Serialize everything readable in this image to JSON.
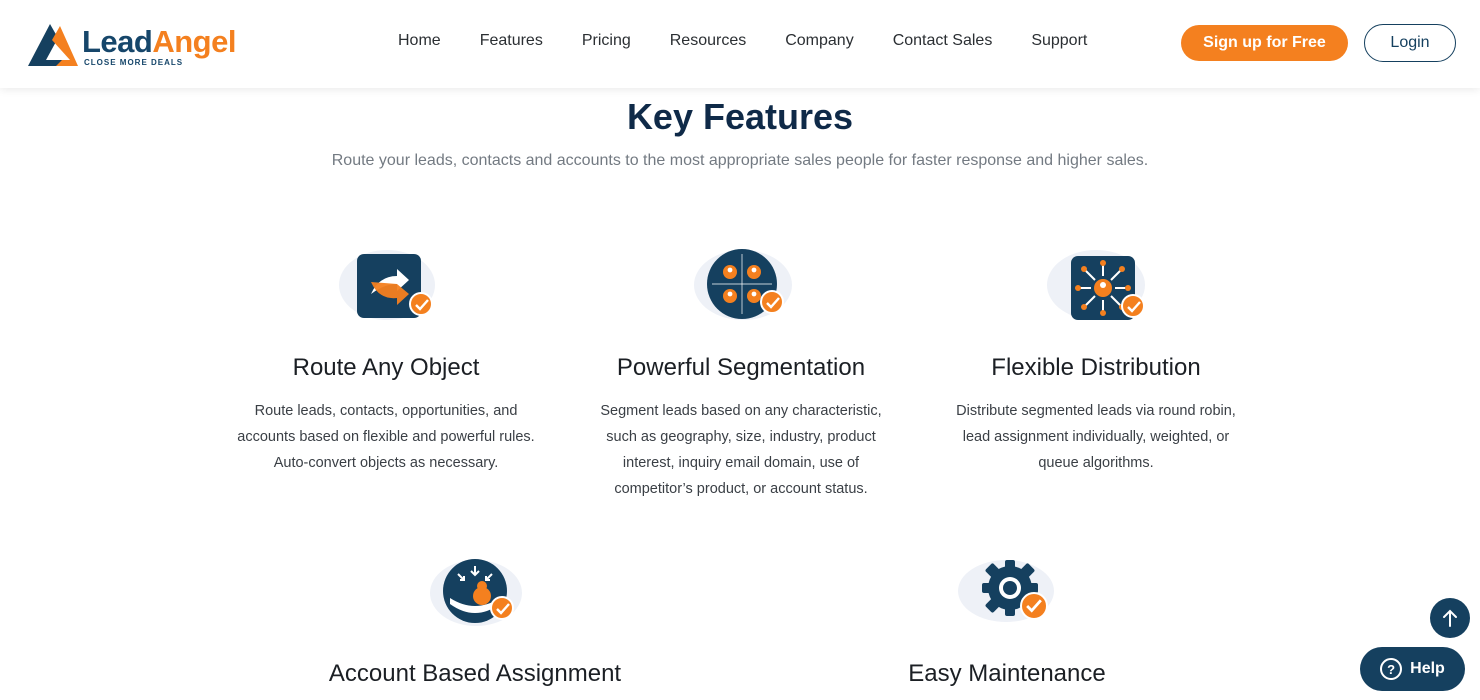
{
  "brand": {
    "name_part1": "Lead",
    "name_part2": "Angel",
    "tagline": "CLOSE MORE DEALS",
    "primary_color": "#15405f",
    "accent_color": "#f4801f"
  },
  "nav": {
    "items": [
      "Home",
      "Features",
      "Pricing",
      "Resources",
      "Company",
      "Contact Sales",
      "Support"
    ]
  },
  "header": {
    "signup_label": "Sign up for Free",
    "login_label": "Login"
  },
  "section": {
    "title": "Key Features",
    "subtitle": "Route your leads, contacts and accounts to the most appropriate sales people for faster response and higher sales."
  },
  "features": [
    {
      "title": "Route Any Object",
      "description": "Route leads, contacts, opportunities, and accounts based on flexible and powerful rules. Auto-convert objects as necessary.",
      "icon": "route-arrows-icon"
    },
    {
      "title": "Powerful Segmentation",
      "description": "Segment leads based on any characteristic, such as geography, size, industry, product interest, inquiry email domain, use of competitor’s product, or account status.",
      "icon": "segmentation-icon"
    },
    {
      "title": "Flexible Distribution",
      "description": "Distribute segmented leads via round robin, lead assignment individually, weighted, or queue algorithms.",
      "icon": "distribution-icon"
    },
    {
      "title": "Account Based Assignment",
      "icon": "account-assignment-icon"
    },
    {
      "title": "Easy Maintenance",
      "icon": "gear-icon"
    }
  ],
  "floating": {
    "help_label": "Help",
    "help_symbol": "?"
  }
}
